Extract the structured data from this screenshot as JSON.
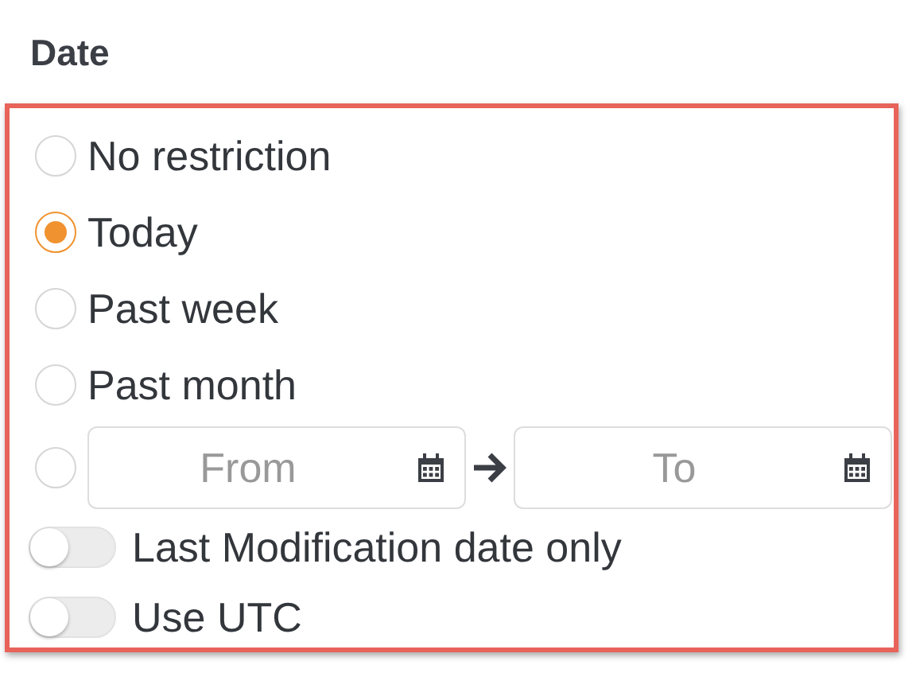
{
  "section_title": "Date",
  "options": [
    {
      "kind": "text",
      "label": "No restriction",
      "selected": false
    },
    {
      "kind": "text",
      "label": "Today",
      "selected": true
    },
    {
      "kind": "text",
      "label": "Past week",
      "selected": false
    },
    {
      "kind": "text",
      "label": "Past month",
      "selected": false
    },
    {
      "kind": "range",
      "from_placeholder": "From",
      "to_placeholder": "To",
      "selected": false
    }
  ],
  "toggles": [
    {
      "label": "Last Modification date only",
      "on": false
    },
    {
      "label": "Use UTC",
      "on": false
    }
  ]
}
